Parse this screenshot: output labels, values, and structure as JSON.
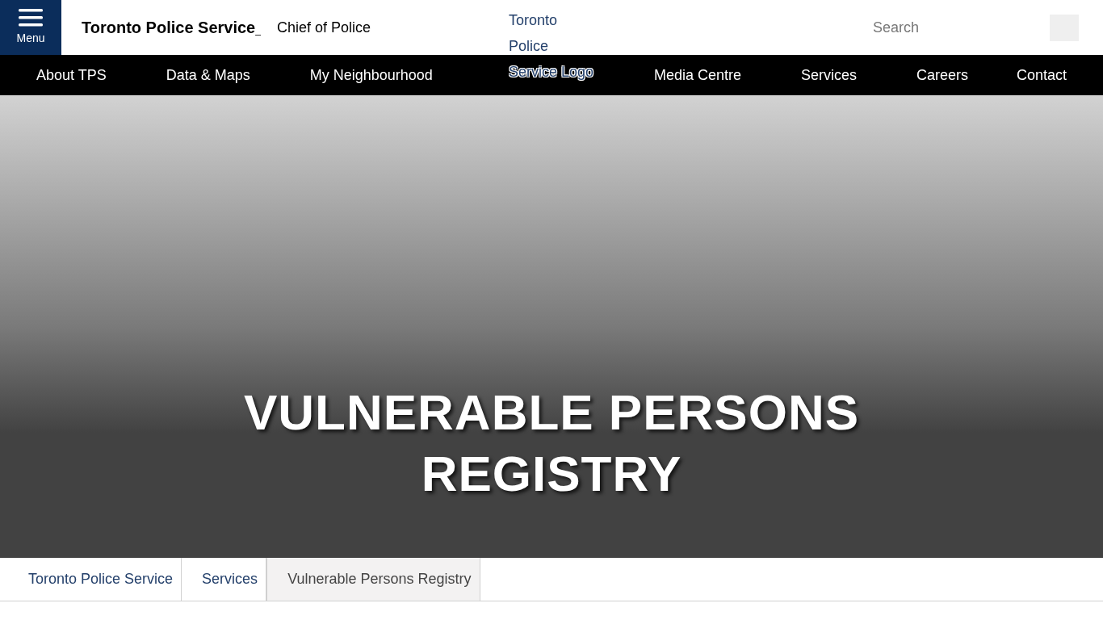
{
  "header": {
    "menu_label": "Menu",
    "site_title": "Toronto Police Service",
    "site_title_suffix": "_",
    "subtitle": "Chief of Police",
    "logo_alt": "Toronto Police Service Logo",
    "search": {
      "placeholder": "Search"
    }
  },
  "nav": [
    "About TPS",
    "Data & Maps",
    "My Neighbourhood",
    "Media Centre",
    "Services",
    "Careers",
    "Contact"
  ],
  "hero": {
    "title": "VULNERABLE PERSONS REGISTRY"
  },
  "breadcrumb": [
    {
      "label": "Toronto Police Service",
      "selected": false
    },
    {
      "label": "Services",
      "selected": false
    },
    {
      "label": "Vulnerable Persons Registry",
      "selected": true
    }
  ]
}
